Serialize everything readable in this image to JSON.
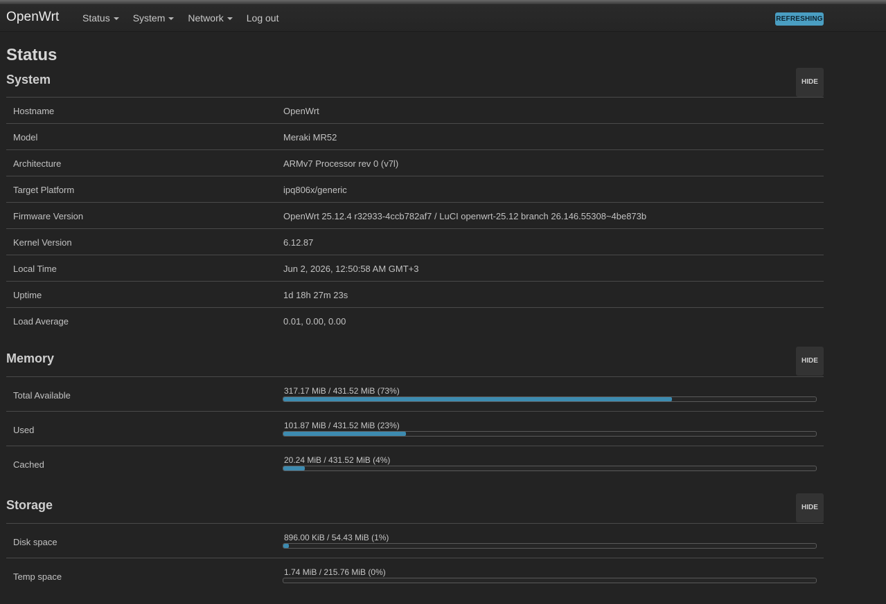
{
  "brand": "OpenWrt",
  "menu": [
    {
      "label": "Status",
      "dropdown": true
    },
    {
      "label": "System",
      "dropdown": true
    },
    {
      "label": "Network",
      "dropdown": true
    },
    {
      "label": "Log out",
      "dropdown": false
    }
  ],
  "refresh_badge": "REFRESHING",
  "page_title": "Status",
  "colors": {
    "accent": "#3d8bb0",
    "badge": "#4a9ec2",
    "background": "#232323"
  },
  "system": {
    "title": "System",
    "hide_label": "HIDE",
    "rows": [
      {
        "label": "Hostname",
        "value": "OpenWrt"
      },
      {
        "label": "Model",
        "value": "Meraki MR52"
      },
      {
        "label": "Architecture",
        "value": "ARMv7 Processor rev 0 (v7l)"
      },
      {
        "label": "Target Platform",
        "value": "ipq806x/generic"
      },
      {
        "label": "Firmware Version",
        "value": "OpenWrt 25.12.4 r32933-4ccb782af7 / LuCI openwrt-25.12 branch 26.146.55308~4be873b"
      },
      {
        "label": "Kernel Version",
        "value": "6.12.87"
      },
      {
        "label": "Local Time",
        "value": "Jun 2, 2026, 12:50:58 AM GMT+3"
      },
      {
        "label": "Uptime",
        "value": "1d 18h 27m 23s"
      },
      {
        "label": "Load Average",
        "value": "0.01, 0.00, 0.00"
      }
    ]
  },
  "memory": {
    "title": "Memory",
    "hide_label": "HIDE",
    "rows": [
      {
        "label": "Total Available",
        "text": "317.17 MiB / 431.52 MiB (73%)",
        "percent": 73
      },
      {
        "label": "Used",
        "text": "101.87 MiB / 431.52 MiB (23%)",
        "percent": 23
      },
      {
        "label": "Cached",
        "text": "20.24 MiB / 431.52 MiB (4%)",
        "percent": 4
      }
    ]
  },
  "storage": {
    "title": "Storage",
    "hide_label": "HIDE",
    "rows": [
      {
        "label": "Disk space",
        "text": "896.00 KiB / 54.43 MiB (1%)",
        "percent": 1
      },
      {
        "label": "Temp space",
        "text": "1.74 MiB / 215.76 MiB (0%)",
        "percent": 0
      }
    ]
  }
}
